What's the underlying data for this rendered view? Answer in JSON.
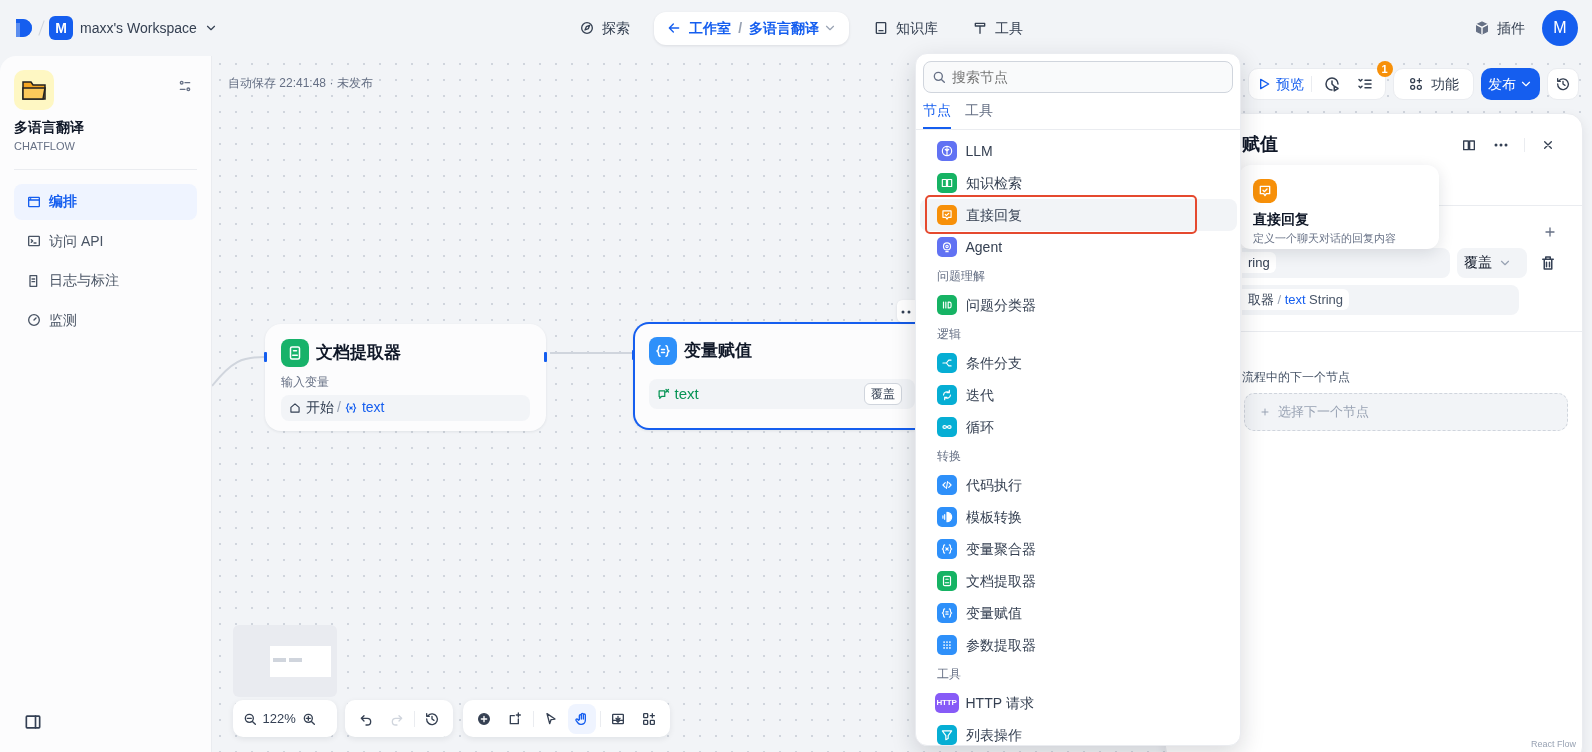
{
  "topbar": {
    "workspace": {
      "initial": "M",
      "name": "maxx's Workspace"
    },
    "nav": [
      {
        "kind": "link",
        "label": "探索"
      },
      {
        "kind": "studio",
        "label": "工作室",
        "separator": "/",
        "app": "多语言翻译"
      },
      {
        "kind": "link",
        "label": "知识库"
      },
      {
        "kind": "link",
        "label": "工具"
      }
    ],
    "plugins": "插件",
    "avatar": "M"
  },
  "sidebar": {
    "app_name": "多语言翻译",
    "app_type": "CHATFLOW",
    "items": [
      {
        "label": "编排",
        "selected": true
      },
      {
        "label": "访问 API",
        "selected": false
      },
      {
        "label": "日志与标注",
        "selected": false
      },
      {
        "label": "监测",
        "selected": false
      }
    ]
  },
  "canvas": {
    "autosave": "自动保存 22:41:48 · 未发布",
    "nodes": [
      {
        "kind": "extractor",
        "title": "文档提取器",
        "color": "#17b26a",
        "selected": false,
        "field_label": "输入变量",
        "source": "开始",
        "separator": "/",
        "variable": "text"
      },
      {
        "kind": "assigner",
        "title": "变量赋值",
        "color": "#2e90fa",
        "selected": true,
        "variable": "text",
        "mode": "覆盖"
      }
    ],
    "zoom": "122%",
    "history_buttons": [
      {
        "disabled": false
      },
      {
        "disabled": true
      },
      {
        "disabled": false
      }
    ],
    "tools": [
      {
        "selected": false
      },
      {
        "selected": false
      },
      {
        "selected": false
      },
      {
        "selected": true
      },
      {
        "selected": false
      },
      {
        "selected": false
      }
    ],
    "attribution": "React Flow"
  },
  "toolbar": {
    "preview": "预览",
    "badge": "1",
    "features": "功能",
    "publish": "发布"
  },
  "panel": {
    "title": "赋值",
    "variable_type": "ring",
    "mode": "覆盖",
    "source": "取器",
    "separator": "/",
    "source_var": "text",
    "source_type": "String",
    "next_hint": "流程中的下一个节点",
    "next_button": "选择下一个节点"
  },
  "tooltip": {
    "title": "直接回复",
    "description": "定义一个聊天对话的回复内容"
  },
  "node_menu": {
    "placeholder": "搜索节点",
    "tabs": [
      {
        "label": "节点",
        "selected": true
      },
      {
        "label": "工具",
        "selected": false
      }
    ],
    "sections": [
      {
        "items": [
          {
            "label": "LLM",
            "color": "#6172f3",
            "hovered": false,
            "outlined": false
          },
          {
            "label": "知识检索",
            "color": "#16b364",
            "hovered": false,
            "outlined": false
          },
          {
            "label": "直接回复",
            "color": "#f79009",
            "hovered": true,
            "outlined": true
          },
          {
            "label": "Agent",
            "color": "#6172f3",
            "hovered": false,
            "outlined": false
          }
        ]
      },
      {
        "heading": "问题理解",
        "items": [
          {
            "label": "问题分类器",
            "color": "#16b364",
            "hovered": false,
            "outlined": false
          }
        ]
      },
      {
        "heading": "逻辑",
        "items": [
          {
            "label": "条件分支",
            "color": "#06aed4",
            "hovered": false,
            "outlined": false
          },
          {
            "label": "迭代",
            "color": "#06aed4",
            "hovered": false,
            "outlined": false
          },
          {
            "label": "循环",
            "color": "#06aed4",
            "hovered": false,
            "outlined": false
          }
        ]
      },
      {
        "heading": "转换",
        "items": [
          {
            "label": "代码执行",
            "color": "#2e90fa",
            "hovered": false,
            "outlined": false
          },
          {
            "label": "模板转换",
            "color": "#2e90fa",
            "hovered": false,
            "outlined": false
          },
          {
            "label": "变量聚合器",
            "color": "#2e90fa",
            "hovered": false,
            "outlined": false
          },
          {
            "label": "文档提取器",
            "color": "#16b364",
            "hovered": false,
            "outlined": false
          },
          {
            "label": "变量赋值",
            "color": "#2e90fa",
            "hovered": false,
            "outlined": false
          },
          {
            "label": "参数提取器",
            "color": "#2e90fa",
            "hovered": false,
            "outlined": false
          }
        ]
      },
      {
        "heading": "工具",
        "items": [
          {
            "label": "HTTP 请求",
            "color": "#875bf7",
            "hovered": false,
            "outlined": false,
            "icon_text": "HTTP"
          },
          {
            "label": "列表操作",
            "color": "#06aed4",
            "hovered": false,
            "outlined": false
          }
        ]
      }
    ]
  }
}
